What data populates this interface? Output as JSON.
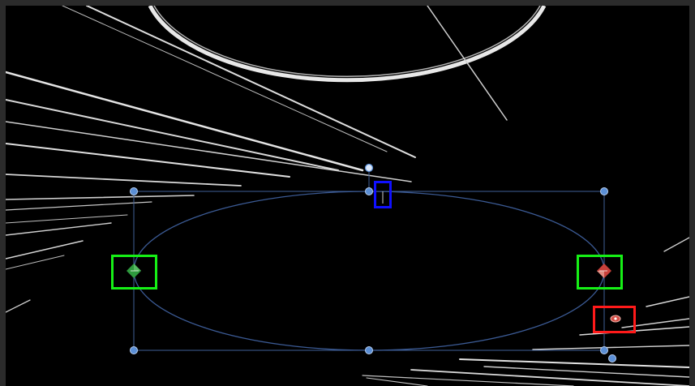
{
  "canvas": {
    "background": "#000000",
    "frame_color": "#2b2b2b"
  },
  "shape": {
    "type": "ellipse",
    "stroke_color": "#3b5a94",
    "bbox_color": "#3f5f98"
  },
  "handles": {
    "fill": "#5b8fd6",
    "stroke": "#b8cff0",
    "rotation_fill": "#dbe8fa",
    "names": [
      "corner-top-left",
      "edge-top",
      "corner-top-right",
      "edge-bottom",
      "corner-bottom-left",
      "corner-bottom-right",
      "rotation-handle",
      "extra-bottom-right"
    ]
  },
  "markers": {
    "left_onscreen_control": {
      "icon": "green-diamond-icon",
      "color": "#2e9a3e"
    },
    "right_onscreen_control": {
      "icon": "red-diamond-icon",
      "color": "#c8403a"
    },
    "anchor_point": {
      "icon": "eye-icon",
      "color": "#d24c44"
    },
    "center_tick": {
      "icon": "vertical-tick-icon",
      "color": "#cfcfcf"
    }
  },
  "highlights": {
    "green": "#16f016",
    "blue": "#1010ff",
    "red": "#ff1a1a"
  },
  "streaks": {
    "color": "#d9d9d9"
  }
}
